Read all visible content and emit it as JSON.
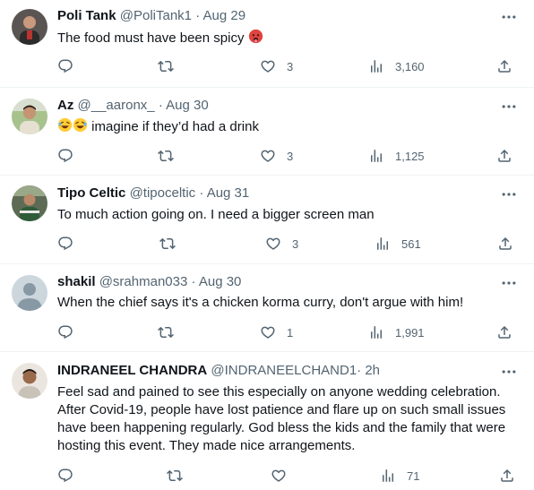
{
  "replies": [
    {
      "name": "Poli Tank",
      "handle": "@PoliTank1",
      "dot": "·",
      "time": "Aug 29",
      "text": "The food must have been spicy",
      "emoji": "hot-face",
      "actions": {
        "replies": "",
        "retweets": "",
        "likes": "3",
        "views": "3,160"
      },
      "avatar_colors": [
        "#3a3a3a",
        "#b8342e"
      ]
    },
    {
      "name": "Az",
      "handle": "@__aaronx_",
      "dot": "·",
      "time": "Aug 30",
      "emoji": "rolling-laughing",
      "text": "imagine if they’d had a drink",
      "actions": {
        "replies": "",
        "retweets": "",
        "likes": "3",
        "views": "1,125"
      },
      "avatar_colors": [
        "#8fae7a",
        "#d8c9a8"
      ]
    },
    {
      "name": "Tipo Celtic",
      "handle": "@tipoceltic",
      "dot": "·",
      "time": "Aug 31",
      "text": "To much action going on. I need a bigger screen man",
      "actions": {
        "replies": "",
        "retweets": "",
        "likes": "3",
        "views": "561"
      },
      "avatar_colors": [
        "#3e4a3c",
        "#6f8a57"
      ]
    },
    {
      "name": "shakil",
      "handle": "@srahman033",
      "dot": "·",
      "time": "Aug 30",
      "text": "When the chief says it's a chicken korma curry, don't argue with him!",
      "actions": {
        "replies": "",
        "retweets": "",
        "likes": "1",
        "views": "1,991"
      },
      "avatar_colors": [
        "#ccd6dd",
        "#8899a6"
      ]
    },
    {
      "name": "INDRANEEL CHANDRA",
      "handle": "@INDRANEELCHAND1",
      "dot": "·",
      "time": "2h",
      "text": "Feel sad and pained to see this especially on anyone wedding celebration. After Covid-19, people have lost patience and flare up on such small issues have been happening regularly. God bless the kids and the family that were hosting this event. They made nice arrangements.",
      "actions": {
        "replies": "",
        "retweets": "",
        "likes": "",
        "views": "71"
      },
      "avatar_colors": [
        "#e9e4dc",
        "#8a5a3c"
      ]
    }
  ],
  "icons": [
    "reply-icon",
    "retweet-icon",
    "like-icon",
    "views-icon",
    "share-icon",
    "more-icon"
  ],
  "colors": {
    "text": "#0f1419",
    "secondary": "#536471",
    "divider": "#eff3f4"
  }
}
